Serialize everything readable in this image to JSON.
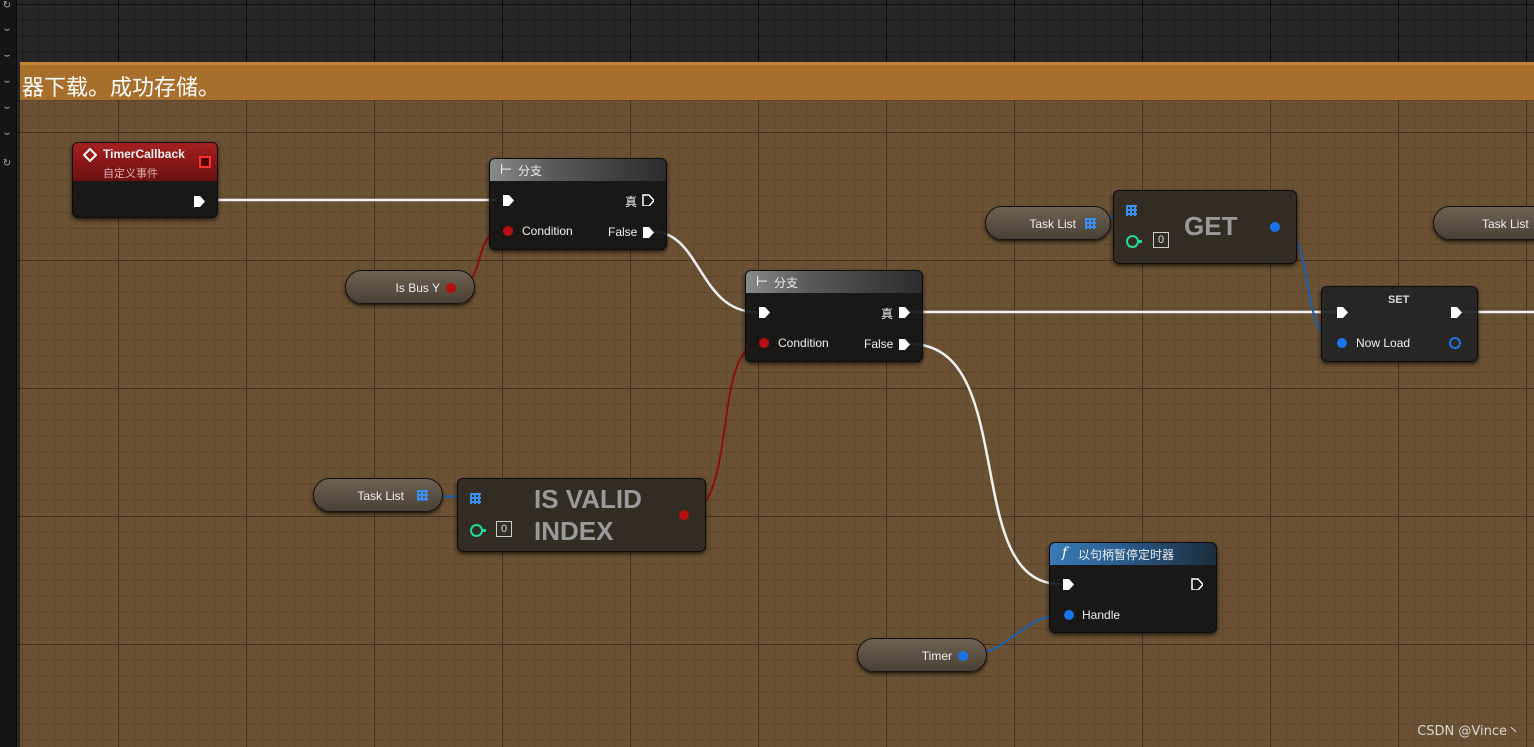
{
  "comment": {
    "title": "器下载。成功存储。"
  },
  "nodes": {
    "timer_callback": {
      "title": "TimerCallback",
      "subtitle": "自定义事件"
    },
    "branch1": {
      "title": "分支",
      "condition_label": "Condition",
      "true_label": "真",
      "false_label": "False"
    },
    "branch2": {
      "title": "分支",
      "condition_label": "Condition",
      "true_label": "真",
      "false_label": "False"
    },
    "get": {
      "title": "GET",
      "index_value": "0"
    },
    "set": {
      "title": "SET",
      "pin_label": "Now Load"
    },
    "is_valid_index": {
      "title_line1": "IS VALID",
      "title_line2": "INDEX",
      "index_value": "0"
    },
    "pause_timer": {
      "title": "以句柄暂停定时器",
      "pin_label": "Handle",
      "func_icon": "function-icon"
    }
  },
  "variables": {
    "is_bus_y": "Is Bus Y",
    "task_list_1": "Task List",
    "task_list_2": "Task List",
    "task_list_3": "Task List",
    "timer": "Timer"
  },
  "watermark": "CSDN @Vince丶",
  "colors": {
    "comment_header": "#a86f2c",
    "exec_wire": "#ffffff",
    "bool_wire": "#8b0f0f",
    "struct_wire": "#1a5fb4",
    "event_header": "#9c1a1a",
    "func_header": "#2a5f8f"
  }
}
